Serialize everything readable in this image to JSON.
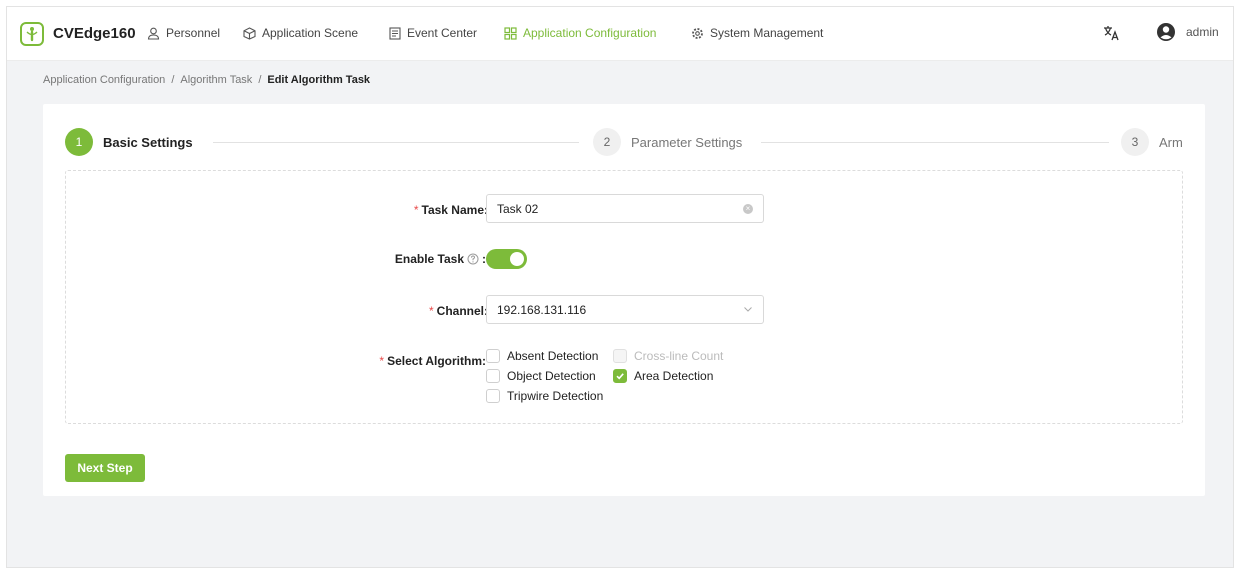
{
  "app": {
    "brand": "CVEdge160",
    "accent_color": "#7dbb3a"
  },
  "nav": [
    {
      "label": "Personnel",
      "icon": "user-icon",
      "active": false
    },
    {
      "label": "Application Scene",
      "icon": "cube-icon",
      "active": false
    },
    {
      "label": "Event Center",
      "icon": "list-icon",
      "active": false
    },
    {
      "label": "Application Configuration",
      "icon": "grid-icon",
      "active": true
    },
    {
      "label": "System Management",
      "icon": "gear-icon",
      "active": false
    }
  ],
  "user": {
    "name": "admin",
    "lang_icon": "translate-icon",
    "avatar_icon": "account-circle-icon"
  },
  "breadcrumb": {
    "items": [
      "Application Configuration",
      "Algorithm Task",
      "Edit Algorithm Task"
    ],
    "separator": "/"
  },
  "steps": [
    {
      "number": "1",
      "label": "Basic Settings",
      "active": true
    },
    {
      "number": "2",
      "label": "Parameter Settings",
      "active": false
    },
    {
      "number": "3",
      "label": "Arm",
      "active": false
    }
  ],
  "form": {
    "required_mark": "*",
    "task_name": {
      "label": "Task Name",
      "colon": ":",
      "value": "Task 02"
    },
    "enable_task": {
      "label": "Enable Task",
      "colon": ":",
      "enabled": true
    },
    "channel": {
      "label": "Channel",
      "colon": ":",
      "value": "192.168.131.116"
    },
    "select_algorithm": {
      "label": "Select Algorithm",
      "colon": ":",
      "options": [
        {
          "label": "Absent Detection",
          "checked": false,
          "disabled": false
        },
        {
          "label": "Cross-line Count",
          "checked": false,
          "disabled": true
        },
        {
          "label": "Object Detection",
          "checked": false,
          "disabled": false
        },
        {
          "label": "Area Detection",
          "checked": true,
          "disabled": false
        },
        {
          "label": "Tripwire Detection",
          "checked": false,
          "disabled": false
        }
      ]
    }
  },
  "actions": {
    "next_label": "Next Step"
  }
}
